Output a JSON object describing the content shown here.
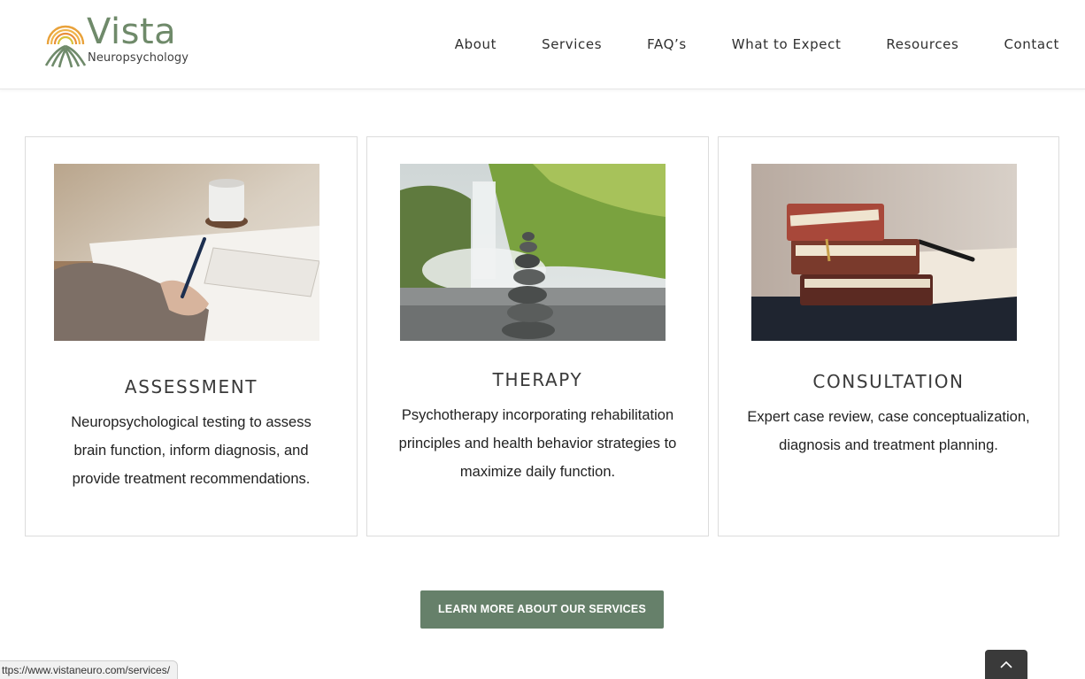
{
  "header": {
    "logo": {
      "word": "Vista",
      "sub": "Neuropsychology",
      "icon": "vista-logo-icon"
    },
    "nav": [
      {
        "label": "About"
      },
      {
        "label": "Services"
      },
      {
        "label": "FAQ’s"
      },
      {
        "label": "What to Expect"
      },
      {
        "label": "Resources"
      },
      {
        "label": "Contact"
      }
    ]
  },
  "services": [
    {
      "title": "ASSESSMENT",
      "text": "Neuropsychological testing to assess brain function, inform diagnosis, and provide treatment recommendations.",
      "image": "person-writing-notes-image"
    },
    {
      "title": "THERAPY",
      "text": "Psychotherapy incorporating rehabilitation principles and health behavior strategies to maximize daily function.",
      "image": "stacked-stones-waterfall-image"
    },
    {
      "title": "CONSULTATION",
      "text": "Expert case review, case conceptualization, diagnosis and treatment planning.",
      "image": "stacked-books-pen-image"
    }
  ],
  "cta": {
    "label": "LEARN MORE ABOUT OUR SERVICES"
  },
  "status_bar": {
    "url": "ttps://www.vistaneuro.com/services/"
  },
  "colors": {
    "brand_green": "#66806a",
    "logo_green": "#6f8a6a",
    "logo_orange": "#e9a23b",
    "dark": "#3a3a3a"
  },
  "go_top": {
    "icon": "chevron-up-icon"
  }
}
